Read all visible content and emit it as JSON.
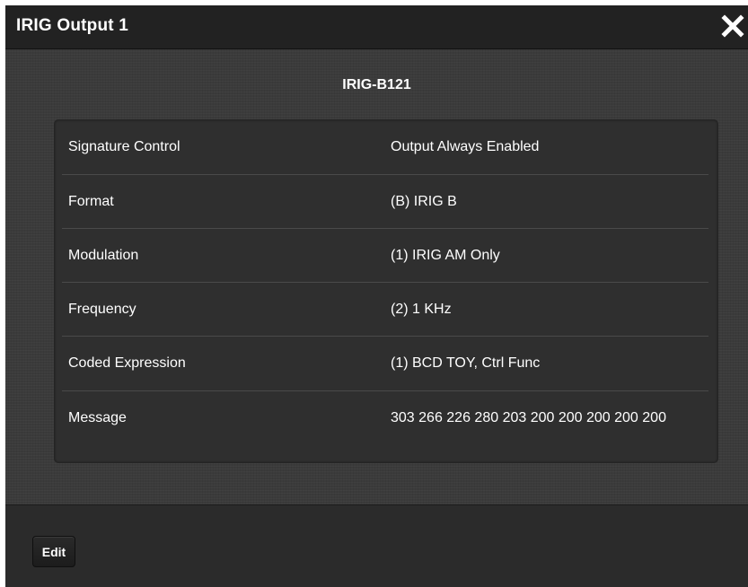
{
  "window": {
    "title": "IRIG Output 1",
    "close_icon": "close-icon"
  },
  "subtitle": "IRIG-B121",
  "rows": [
    {
      "label": "Signature Control",
      "value": "Output Always Enabled"
    },
    {
      "label": "Format",
      "value": "(B) IRIG B"
    },
    {
      "label": "Modulation",
      "value": "(1) IRIG AM Only"
    },
    {
      "label": "Frequency",
      "value": "(2) 1 KHz"
    },
    {
      "label": "Coded Expression",
      "value": "(1) BCD TOY, Ctrl Func"
    },
    {
      "label": "Message",
      "value": "303 266 226 280 203 200 200 200 200 200"
    }
  ],
  "footer": {
    "edit_label": "Edit"
  },
  "colors": {
    "titlebar": "#222222",
    "content_bg": "#3b3b3b",
    "panel_bg": "#2f2f2f",
    "text": "#ffffff"
  }
}
